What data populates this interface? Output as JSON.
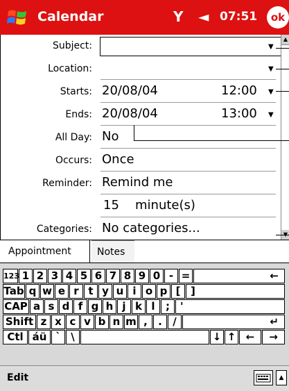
{
  "titlebar": {
    "title": "Calendar",
    "clock": "07:51",
    "ok_label": "ok",
    "signal_icon": "Y",
    "speaker_icon": "◄"
  },
  "form": {
    "subject_label": "Subject:",
    "subject_value": "",
    "location_label": "Location:",
    "location_value": "",
    "starts_label": "Starts:",
    "starts_date": "20/08/04",
    "starts_time": "12:00",
    "ends_label": "Ends:",
    "ends_date": "20/08/04",
    "ends_time": "13:00",
    "allday_label": "All Day:",
    "allday_value": "No",
    "occurs_label": "Occurs:",
    "occurs_value": "Once",
    "reminder_label": "Reminder:",
    "reminder_value": "Remind me",
    "reminder_amount": "15",
    "reminder_unit": "minute(s)",
    "categories_label": "Categories:",
    "categories_value": "No categories..."
  },
  "tabs": {
    "appointment": "Appointment",
    "notes": "Notes"
  },
  "keyboard": {
    "row1": [
      "123",
      "1",
      "2",
      "3",
      "4",
      "5",
      "6",
      "7",
      "8",
      "9",
      "0",
      "-",
      "=",
      "←"
    ],
    "row2": [
      "Tab",
      "q",
      "w",
      "e",
      "r",
      "t",
      "y",
      "u",
      "i",
      "o",
      "p",
      "[",
      "]"
    ],
    "row3": [
      "CAP",
      "a",
      "s",
      "d",
      "f",
      "g",
      "h",
      "j",
      "k",
      "l",
      ";",
      "'"
    ],
    "row4": [
      "Shift",
      "z",
      "x",
      "c",
      "v",
      "b",
      "n",
      "m",
      ",",
      ".",
      "/",
      "↵"
    ],
    "row5": [
      "Ctl",
      "áü",
      "`",
      "\\",
      "",
      "↓",
      "↑",
      "←",
      "→"
    ]
  },
  "menubar": {
    "edit_label": "Edit"
  }
}
